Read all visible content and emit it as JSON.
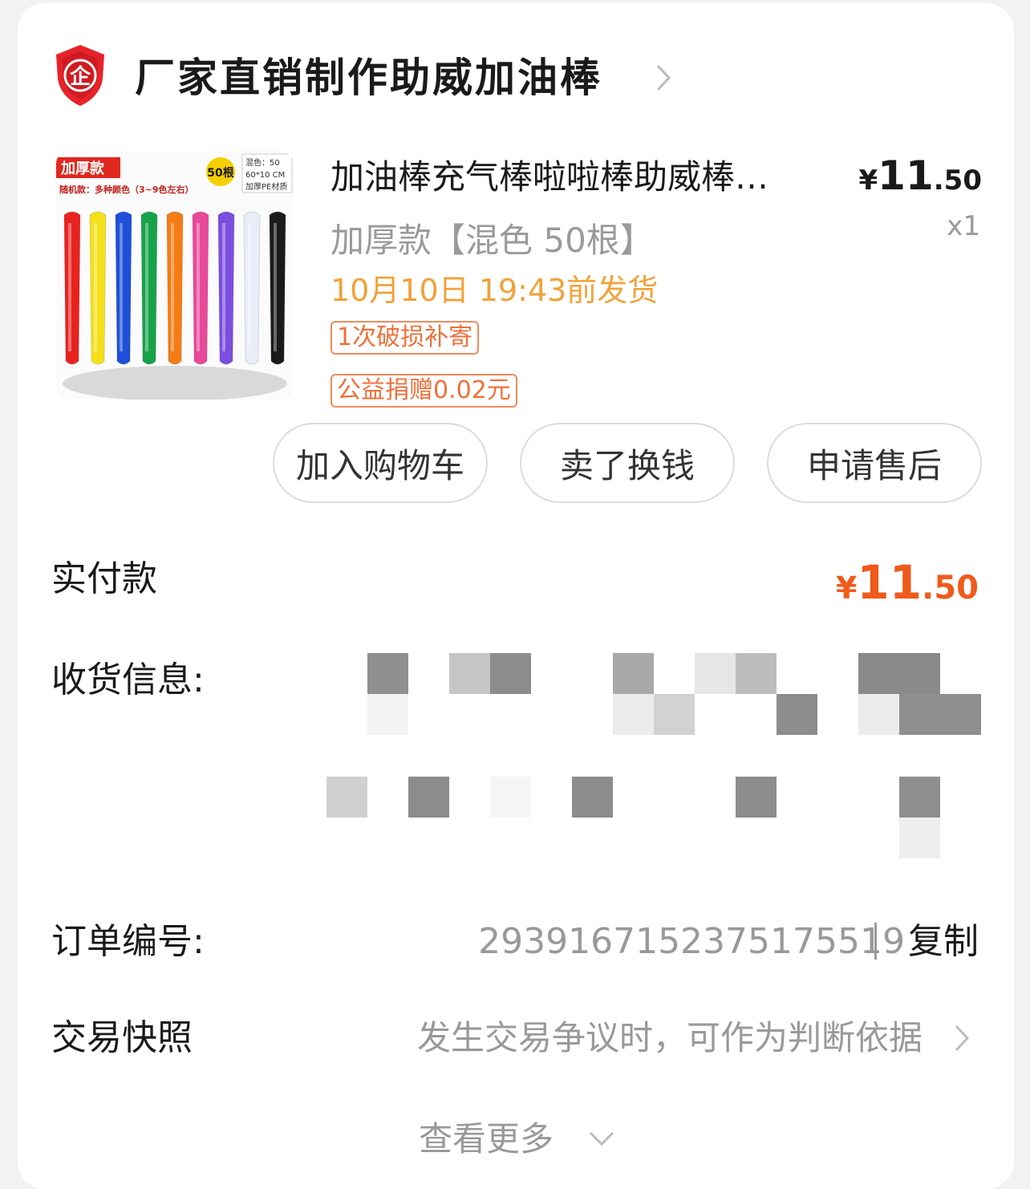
{
  "shop": {
    "name": "厂家直销制作助威加油棒",
    "icon": "enterprise-shield-icon",
    "icon_glyph": "企",
    "brand_color": "#e6232a"
  },
  "product": {
    "title": "加油棒充气棒啦啦棒助威棒…",
    "price": {
      "yen": "¥",
      "int": "11",
      "dec": ".50"
    },
    "qty": "x1",
    "spec": "加厚款【混色 50根】",
    "ship_time": "10月10日 19:43前发货",
    "tags": [
      "1次破损补寄",
      "公益捐赠0.02元"
    ],
    "image": {
      "badge": "加厚款",
      "subtitle": "随机款：多种颜色（3~9色左右）",
      "count_badge": "50根",
      "info_lines": [
        "混色：50",
        "60*10 CM",
        "加厚PE材质"
      ],
      "stick_colors": [
        "#e8231f",
        "#f4e01a",
        "#1d4fd8",
        "#17a34a",
        "#f57c14",
        "#e8499a",
        "#7b4ee0",
        "#e9edf7",
        "#1a1a1a"
      ]
    }
  },
  "actions": {
    "add_cart": "加入购物车",
    "resell": "卖了换钱",
    "after_sale": "申请售后"
  },
  "payment": {
    "label": "实付款",
    "amount": {
      "yen": "¥",
      "int": "11",
      "dec": ".50"
    },
    "color": "#f05a1a"
  },
  "address": {
    "label": "收货信息:"
  },
  "order": {
    "label": "订单编号:",
    "number": "2939167152375175519",
    "separator": "|",
    "copy": "复制"
  },
  "snapshot": {
    "label": "交易快照",
    "desc": "发生交易争议时，可作为判断依据"
  },
  "more": {
    "label": "查看更多"
  }
}
